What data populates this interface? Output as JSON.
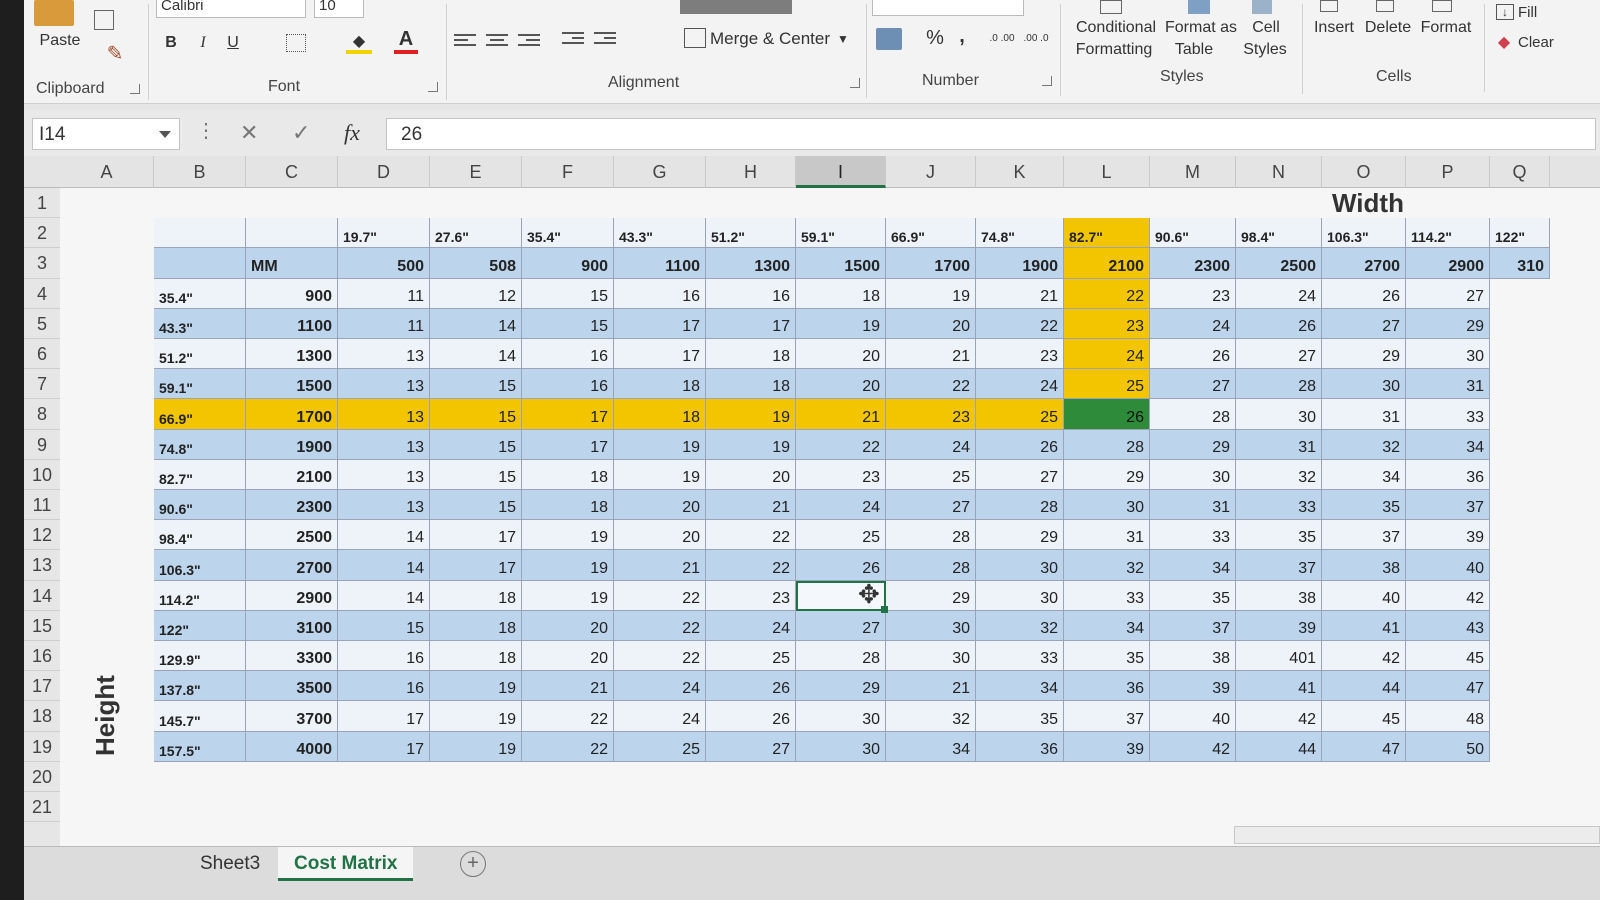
{
  "ribbon": {
    "clipboard": {
      "label": "Clipboard",
      "paste_label": "Paste"
    },
    "font": {
      "label": "Font",
      "font_name": "Calibri",
      "font_size": "10",
      "bold": "B",
      "italic": "I",
      "underline": "U"
    },
    "alignment": {
      "label": "Alignment",
      "merge_center": "Merge & Center"
    },
    "number": {
      "label": "Number",
      "percent": "%",
      "comma": ",",
      "increase_decimal": ".0 .00",
      "decrease_decimal": ".00 .0"
    },
    "styles": {
      "label": "Styles",
      "conditional_1": "Conditional",
      "conditional_2": "Formatting",
      "format_table_1": "Format as",
      "format_table_2": "Table",
      "cell_styles_1": "Cell",
      "cell_styles_2": "Styles"
    },
    "cells": {
      "label": "Cells",
      "insert": "Insert",
      "delete": "Delete",
      "format": "Format"
    },
    "editing": {
      "fill": "Fill",
      "clear": "Clear"
    }
  },
  "formula_bar": {
    "name_box": "I14",
    "cancel": "✕",
    "enter": "✓",
    "fx": "fx",
    "value": "26"
  },
  "columns": [
    "A",
    "B",
    "C",
    "D",
    "E",
    "F",
    "G",
    "H",
    "I",
    "J",
    "K",
    "L",
    "M",
    "N",
    "O",
    "P",
    "Q"
  ],
  "rows": [
    "1",
    "2",
    "3",
    "4",
    "5",
    "6",
    "7",
    "8",
    "9",
    "10",
    "11",
    "12",
    "13",
    "14",
    "15",
    "16",
    "17",
    "18",
    "19",
    "20",
    "21"
  ],
  "selected_column": "I",
  "selected_cell": "I14",
  "sheet": {
    "width_title": "Width",
    "height_title": "Height",
    "mm_label": "MM",
    "width_inches": [
      "19.7\"",
      "27.6\"",
      "35.4\"",
      "43.3\"",
      "51.2\"",
      "59.1\"",
      "66.9\"",
      "74.8\"",
      "82.7\"",
      "90.6\"",
      "98.4\"",
      "106.3\"",
      "114.2\"",
      "122\""
    ],
    "width_mm": [
      "500",
      "508",
      "900",
      "1100",
      "1300",
      "1500",
      "1700",
      "1900",
      "2100",
      "2300",
      "2500",
      "2700",
      "2900",
      "310"
    ],
    "height_inches": [
      "35.4\"",
      "43.3\"",
      "51.2\"",
      "59.1\"",
      "66.9\"",
      "74.8\"",
      "82.7\"",
      "90.6\"",
      "98.4\"",
      "106.3\"",
      "114.2\"",
      "122\"",
      "129.9\"",
      "137.8\"",
      "145.7\"",
      "157.5\""
    ],
    "height_mm": [
      "900",
      "1100",
      "1300",
      "1500",
      "1700",
      "1900",
      "2100",
      "2300",
      "2500",
      "2700",
      "2900",
      "3100",
      "3300",
      "3500",
      "3700",
      "4000"
    ],
    "matrix": [
      [
        "11",
        "12",
        "15",
        "16",
        "16",
        "18",
        "19",
        "21",
        "22",
        "23",
        "24",
        "26",
        "27"
      ],
      [
        "11",
        "14",
        "15",
        "17",
        "17",
        "19",
        "20",
        "22",
        "23",
        "24",
        "26",
        "27",
        "29"
      ],
      [
        "13",
        "14",
        "16",
        "17",
        "18",
        "20",
        "21",
        "23",
        "24",
        "26",
        "27",
        "29",
        "30"
      ],
      [
        "13",
        "15",
        "16",
        "18",
        "18",
        "20",
        "22",
        "24",
        "25",
        "27",
        "28",
        "30",
        "31"
      ],
      [
        "13",
        "15",
        "17",
        "18",
        "19",
        "21",
        "23",
        "25",
        "26",
        "28",
        "30",
        "31",
        "33"
      ],
      [
        "13",
        "15",
        "17",
        "19",
        "19",
        "22",
        "24",
        "26",
        "28",
        "29",
        "31",
        "32",
        "34"
      ],
      [
        "13",
        "15",
        "18",
        "19",
        "20",
        "23",
        "25",
        "27",
        "29",
        "30",
        "32",
        "34",
        "36"
      ],
      [
        "13",
        "15",
        "18",
        "20",
        "21",
        "24",
        "27",
        "28",
        "30",
        "31",
        "33",
        "35",
        "37"
      ],
      [
        "14",
        "17",
        "19",
        "20",
        "22",
        "25",
        "28",
        "29",
        "31",
        "33",
        "35",
        "37",
        "39"
      ],
      [
        "14",
        "17",
        "19",
        "21",
        "22",
        "26",
        "28",
        "30",
        "32",
        "34",
        "37",
        "38",
        "40"
      ],
      [
        "14",
        "18",
        "19",
        "22",
        "23",
        "",
        "29",
        "30",
        "33",
        "35",
        "38",
        "40",
        "42"
      ],
      [
        "15",
        "18",
        "20",
        "22",
        "24",
        "27",
        "30",
        "32",
        "34",
        "37",
        "39",
        "41",
        "43"
      ],
      [
        "16",
        "18",
        "20",
        "22",
        "25",
        "28",
        "30",
        "33",
        "35",
        "38",
        "401",
        "42",
        "45"
      ],
      [
        "16",
        "19",
        "21",
        "24",
        "26",
        "29",
        "21",
        "34",
        "36",
        "39",
        "41",
        "44",
        "47"
      ],
      [
        "17",
        "19",
        "22",
        "24",
        "26",
        "30",
        "32",
        "35",
        "37",
        "40",
        "42",
        "45",
        "48"
      ],
      [
        "17",
        "19",
        "22",
        "25",
        "27",
        "30",
        "34",
        "36",
        "39",
        "42",
        "44",
        "47",
        "50"
      ]
    ],
    "highlight_row_index": 4,
    "highlight_col_index": 8,
    "colors": {
      "header_blue": "#bcd4ec",
      "highlight": "#f2c500",
      "target": "#2e8b3a",
      "accent": "#217346"
    }
  },
  "tabs": [
    {
      "label": "Sheet3",
      "active": false
    },
    {
      "label": "Cost Matrix",
      "active": true
    }
  ],
  "add_sheet": "+"
}
